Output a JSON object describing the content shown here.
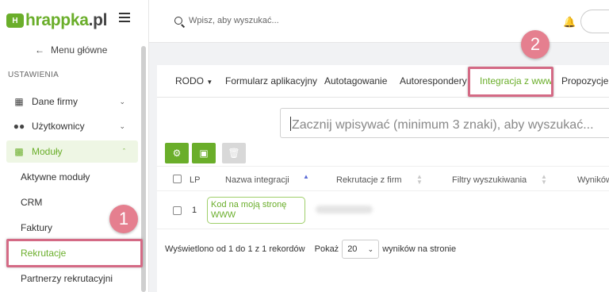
{
  "app": {
    "logo_text_main": "hrappka",
    "logo_text_suffix": ".pl",
    "logo_mark": "H"
  },
  "sidebar": {
    "back_label": "Menu główne",
    "section_title": "USTAWIENIA",
    "items": [
      {
        "label": "Dane firmy",
        "icon": "building-icon"
      },
      {
        "label": "Użytkownicy",
        "icon": "users-icon"
      },
      {
        "label": "Moduły",
        "icon": "puzzle-icon"
      }
    ],
    "sub_items": [
      "Aktywne moduły",
      "CRM",
      "Faktury",
      "Rekrutacje",
      "Partnerzy rekrutacyjni"
    ]
  },
  "topbar": {
    "search_placeholder": "Wpisz, aby wyszukać..."
  },
  "annotations": {
    "badge_1": "1",
    "badge_2": "2",
    "highlight_color": "#d46a85"
  },
  "tabs": [
    "RODO",
    "Formularz aplikacyjny",
    "Autotagowanie",
    "Autorespondery",
    "Integracja z www",
    "Propozycje"
  ],
  "search": {
    "placeholder": "Zacznij wpisywać (minimum 3 znaki), aby wyszukać..."
  },
  "table": {
    "columns": [
      "LP",
      "Nazwa integracji",
      "Rekrutacje z firm",
      "Filtry wyszukiwania",
      "Wyników"
    ],
    "rows": [
      {
        "lp": "1",
        "name": "Kod na moją stronę WWW"
      }
    ]
  },
  "footer": {
    "summary": "Wyświetlono od 1 do 1 z 1 rekordów",
    "show_label": "Pokaż",
    "page_size": "20",
    "per_page_label": "wyników na stronie"
  },
  "colors": {
    "accent": "#6aae2a",
    "badge": "#e57f8f"
  }
}
